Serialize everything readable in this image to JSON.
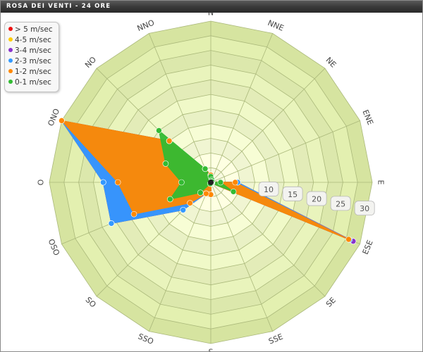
{
  "window": {
    "title": "ROSA DEI VENTI - 24 ORE"
  },
  "chart_data": {
    "type": "radar",
    "directions": [
      "N",
      "NNE",
      "NE",
      "ENE",
      "E",
      "ESE",
      "SE",
      "SSE",
      "S",
      "SSO",
      "SO",
      "OSO",
      "O",
      "ONO",
      "NO",
      "NNO"
    ],
    "radial_ticks": [
      10,
      15,
      20,
      25,
      30
    ],
    "rmax": 33,
    "series": [
      {
        "name": "0-1 m/sec",
        "color": "#33bb33",
        "values": [
          1.2,
          0.6,
          0.3,
          0.3,
          2,
          5,
          0.3,
          0.3,
          0.3,
          0.3,
          3,
          9,
          6,
          10,
          15,
          3
        ]
      },
      {
        "name": "1-2 m/sec",
        "color": "#ff8800",
        "values": [
          1.5,
          0.6,
          0.3,
          0.3,
          5,
          30.5,
          0.3,
          0.3,
          2.5,
          2.5,
          6,
          17,
          19,
          33,
          12,
          3
        ]
      },
      {
        "name": "2-3 m/sec",
        "color": "#3399ff",
        "values": [
          1.5,
          0.6,
          0.3,
          0.3,
          5.5,
          30.7,
          0.3,
          0.3,
          2.5,
          2.5,
          8,
          22,
          22,
          33,
          12,
          3
        ]
      },
      {
        "name": "3-4 m/sec",
        "color": "#8833cc",
        "values": [
          1.5,
          0.6,
          0.3,
          0.3,
          5.5,
          31.5,
          0.3,
          0.3,
          2.5,
          2.5,
          8,
          22,
          22,
          33,
          12,
          3
        ]
      },
      {
        "name": "4-5 m/sec",
        "color": "#ffcc00",
        "values": [
          1.5,
          0.6,
          0.3,
          0.3,
          5.5,
          31.5,
          0.3,
          0.3,
          2.5,
          2.5,
          8,
          22,
          22,
          33,
          12,
          3
        ]
      },
      {
        "name": "> 5 m/sec",
        "color": "#ee1111",
        "values": [
          1.5,
          0.6,
          0.3,
          0.3,
          5.5,
          31.5,
          0.3,
          0.3,
          2.5,
          2.5,
          8,
          22,
          22,
          33,
          12,
          3
        ]
      }
    ],
    "legend_placement": "top-left",
    "grid": true
  }
}
